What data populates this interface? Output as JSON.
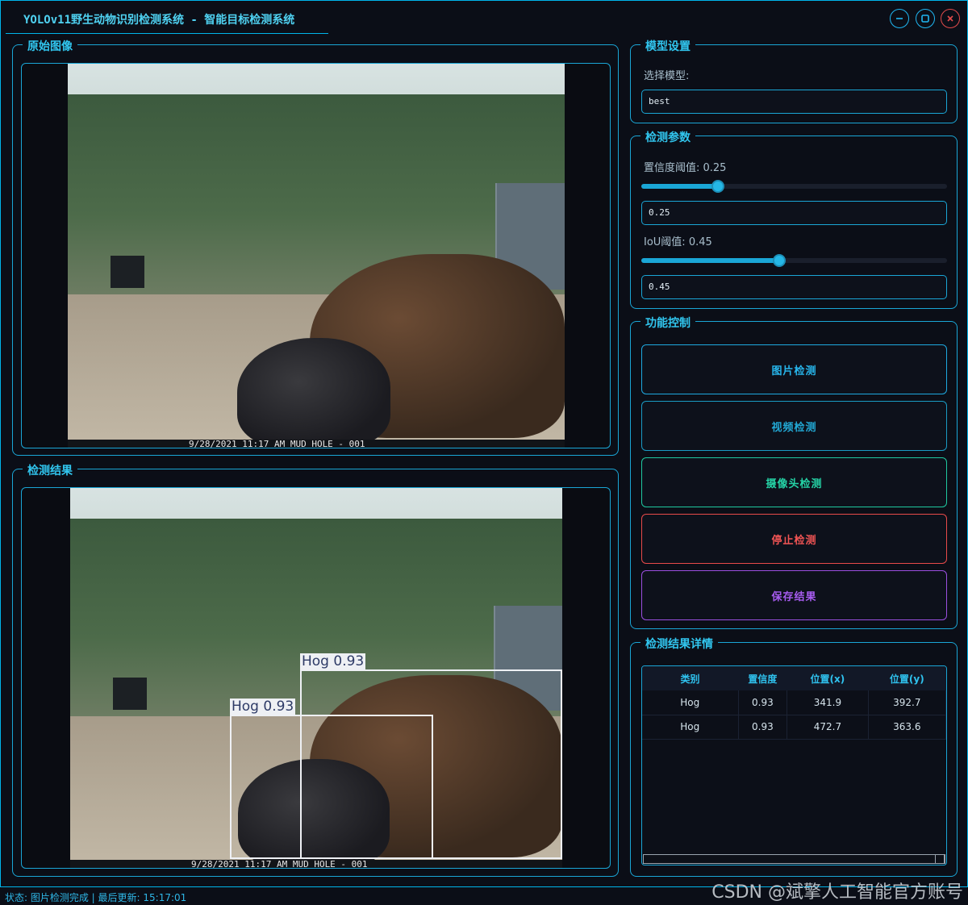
{
  "window": {
    "title": "YOLOv11野生动物识别检测系统 - 智能目标检测系统"
  },
  "original_panel": {
    "title": "原始图像",
    "stamp": "9/28/2021  11:17 AM   MUD HOLE - 001"
  },
  "result_panel": {
    "title": "检测结果",
    "stamp": "9/28/2021  11:17 AM   MUD HOLE - 001",
    "boxes": [
      {
        "label": "Hog 0.93"
      },
      {
        "label": "Hog 0.93"
      }
    ]
  },
  "model_settings": {
    "title": "模型设置",
    "select_label": "选择模型:",
    "selected_model": "best"
  },
  "detect_params": {
    "title": "检测参数",
    "confidence_label": "置信度阈值: 0.25",
    "confidence_value": "0.25",
    "confidence": 0.25,
    "iou_label": "IoU阈值: 0.45",
    "iou_value": "0.45",
    "iou": 0.45
  },
  "controls": {
    "title": "功能控制",
    "image_detect": "图片检测",
    "video_detect": "视频检测",
    "camera_detect": "摄像头检测",
    "stop_detect": "停止检测",
    "save_results": "保存结果"
  },
  "results_detail": {
    "title": "检测结果详情",
    "columns": [
      "类别",
      "置信度",
      "位置(x)",
      "位置(y)"
    ],
    "rows": [
      [
        "Hog",
        "0.93",
        "341.9",
        "392.7"
      ],
      [
        "Hog",
        "0.93",
        "472.7",
        "363.6"
      ]
    ]
  },
  "status": {
    "text": "状态: 图片检测完成 | 最后更新: 15:17:01"
  },
  "watermark": "CSDN @斌擎人工智能官方账号",
  "colors": {
    "accent": "#1aa6d6",
    "image_btn": "#1ea9e0",
    "video_btn": "#1a9bc4",
    "camera_btn": "#1fc9a0",
    "stop_btn": "#e84a4a",
    "save_btn": "#9b4fe0"
  }
}
